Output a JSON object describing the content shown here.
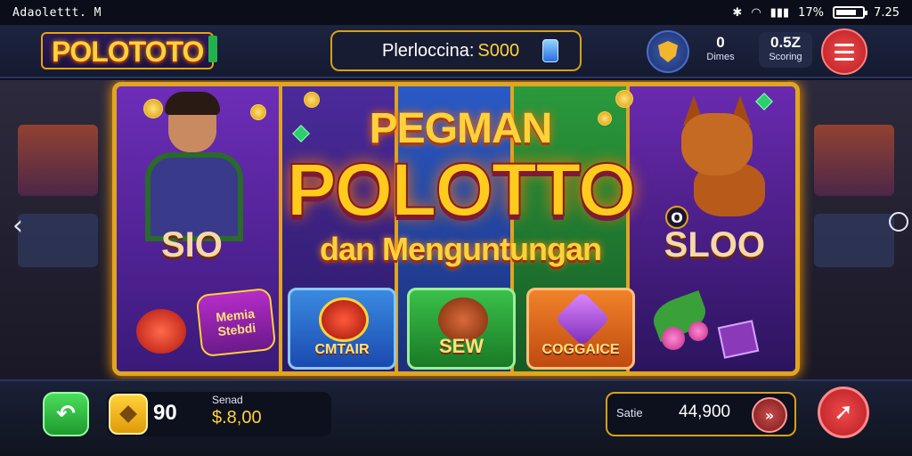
{
  "status_bar": {
    "left_text": "Adaolettt.  M",
    "signal_pct": "17%",
    "time": "7.25",
    "battery_level": 0.8
  },
  "header": {
    "logo": "POLOTOTO",
    "promo_label": "Plerloccina:",
    "promo_amount": "S000",
    "dimes_value": "0",
    "dimes_label": "Dimes",
    "scoring_value": "0.5Z",
    "scoring_label": "Scoring"
  },
  "banner": {
    "title_top": "PEGMAN",
    "title_main": "POLOTTO",
    "title_sub": "dan Menguntungan",
    "bet_left": "SIO",
    "bet_right": "SLOO",
    "bubble": "O"
  },
  "tiles": [
    {
      "label": "Memia Stebdi"
    },
    {
      "label": "CMTAIR"
    },
    {
      "label": "SEW"
    },
    {
      "label": "COGGAICE"
    }
  ],
  "footer": {
    "credit_count": "90",
    "bet_label": "Senad",
    "bet_value": "$.8,00",
    "win_label": "Satie",
    "win_value": "44,900"
  },
  "icons": {
    "undo": "undo-arrow-icon",
    "coin": "coin-icon",
    "fast_forward": "fast-forward-icon",
    "spin": "spin-arrow-icon",
    "menu": "hamburger-menu-icon",
    "shield": "shield-icon"
  },
  "colors": {
    "gold": "#ffd23a",
    "frame_gold": "#e0a521",
    "menu_red": "#d3262e",
    "undo_green": "#2ebd3f"
  }
}
